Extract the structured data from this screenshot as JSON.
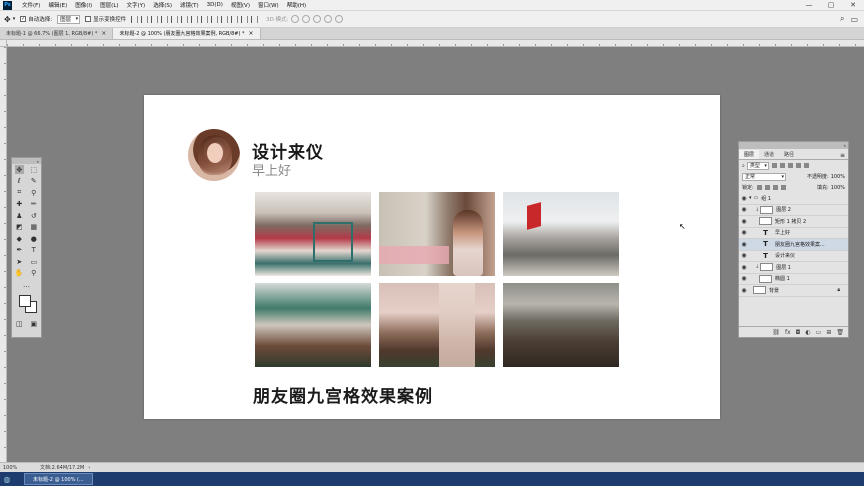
{
  "menubar": {
    "logo": "Ps",
    "items": [
      "文件(F)",
      "编辑(E)",
      "图像(I)",
      "图层(L)",
      "文字(Y)",
      "选择(S)",
      "滤镜(T)",
      "3D(D)",
      "视图(V)",
      "窗口(W)",
      "帮助(H)"
    ],
    "minimize": "—",
    "maximize": "▢",
    "close": "✕"
  },
  "options": {
    "auto_select_label": "自动选择:",
    "auto_select_checked": "✓",
    "auto_select_value": "图层",
    "transform_controls_label": "显示变换控件",
    "mode_label": "3D 模式:"
  },
  "tabs": [
    {
      "label": "未标题-1 @ 66.7% (图层 1, RGB/8#) *",
      "close": "×"
    },
    {
      "label": "未标题-2 @ 100% (朋友圈九宫格效果案例, RGB/8#) *",
      "close": "×"
    }
  ],
  "canvas": {
    "title": "设计来仪",
    "subtitle": "早上好",
    "footer": "朋友圈九宫格效果案例"
  },
  "layers_panel": {
    "tabs": [
      "图层",
      "通道",
      "路径"
    ],
    "filter_kind": "类型",
    "blend_mode": "正常",
    "opacity_label": "不透明度:",
    "opacity_value": "100%",
    "lock_label": "锁定:",
    "fill_label": "填充:",
    "fill_value": "100%",
    "layers": [
      {
        "name": "组 1",
        "kind": "group"
      },
      {
        "name": "图层 2",
        "kind": "pixel"
      },
      {
        "name": "矩形 1 拷贝 2",
        "kind": "shape"
      },
      {
        "name": "早上好",
        "kind": "text"
      },
      {
        "name": "朋友圈九宫格效果案...",
        "kind": "text"
      },
      {
        "name": "设计来仪",
        "kind": "text"
      },
      {
        "name": "图层 1",
        "kind": "pixel"
      },
      {
        "name": "椭圆 1",
        "kind": "shape"
      },
      {
        "name": "背景",
        "kind": "background"
      }
    ]
  },
  "status": {
    "zoom": "100%",
    "doc": "文档:2.64M/17.2M"
  },
  "taskbar": {
    "ps_task": "未标题-2 @ 100% (..."
  },
  "colors": {
    "workspace": "#7f7f7f",
    "canvas": "#ffffff",
    "taskbar": "#1f3c6e"
  }
}
